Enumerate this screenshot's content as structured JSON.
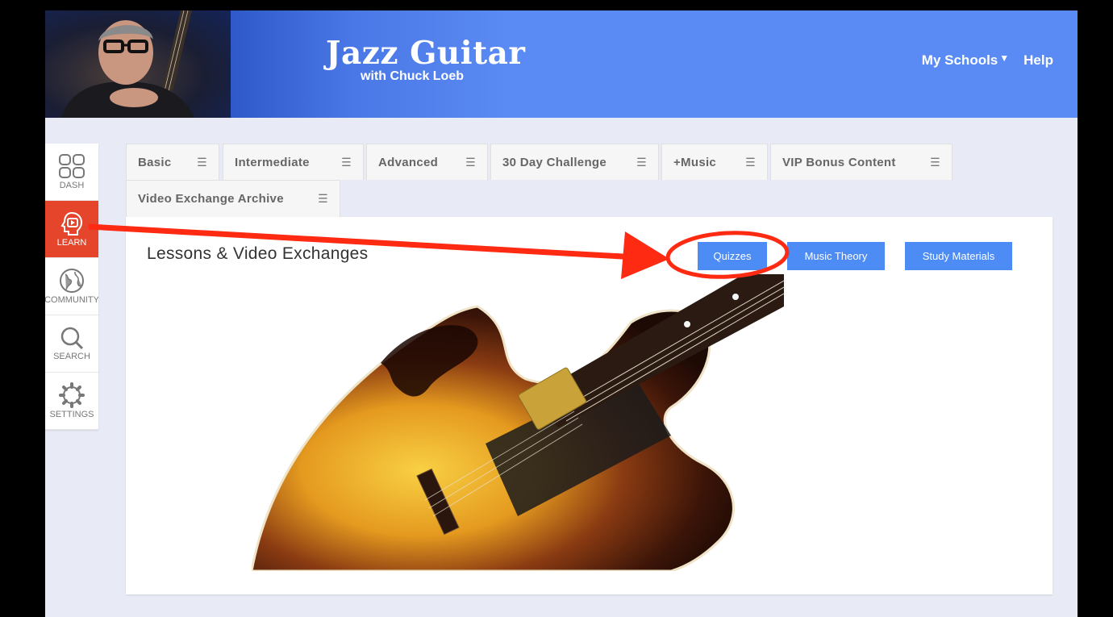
{
  "header": {
    "title": "Jazz Guitar",
    "subtitle": "with Chuck Loeb",
    "nav": {
      "my_schools": "My Schools",
      "help": "Help"
    }
  },
  "sidebar": {
    "items": [
      {
        "label": "DASH",
        "icon": "grid-icon"
      },
      {
        "label": "LEARN",
        "icon": "learn-icon"
      },
      {
        "label": "COMMUNITY",
        "icon": "globe-icon"
      },
      {
        "label": "SEARCH",
        "icon": "search-icon"
      },
      {
        "label": "SETTINGS",
        "icon": "gear-icon"
      }
    ],
    "active": "LEARN"
  },
  "tabs": [
    {
      "label": "Basic"
    },
    {
      "label": "Intermediate"
    },
    {
      "label": "Advanced"
    },
    {
      "label": "30 Day Challenge"
    },
    {
      "label": "+Music"
    },
    {
      "label": "VIP Bonus Content"
    },
    {
      "label": "Video Exchange Archive"
    }
  ],
  "content": {
    "title": "Lessons & Video Exchanges",
    "buttons": {
      "quizzes": "Quizzes",
      "music_theory": "Music Theory",
      "study_materials": "Study Materials"
    }
  },
  "colors": {
    "accent_blue": "#4d8bf5",
    "header_blue": "#5a8af3",
    "learn_red": "#e5452b",
    "annotation_red": "#ff2a12"
  }
}
